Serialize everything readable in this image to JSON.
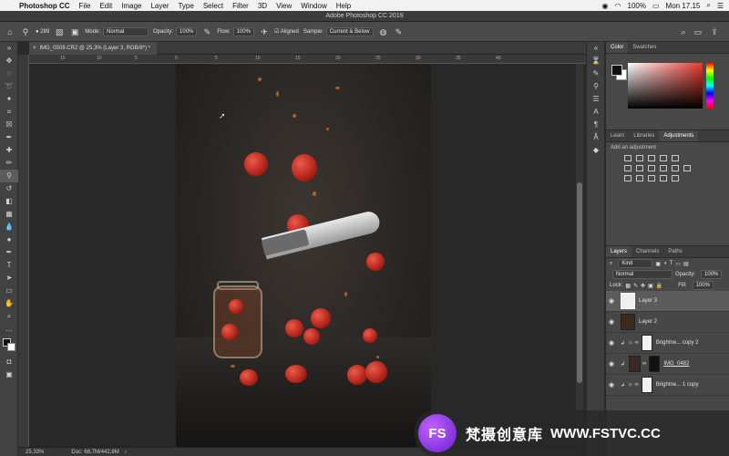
{
  "mac_menu": {
    "app": "Photoshop CC",
    "items": [
      "File",
      "Edit",
      "Image",
      "Layer",
      "Type",
      "Select",
      "Filter",
      "3D",
      "View",
      "Window",
      "Help"
    ],
    "battery": "100%",
    "time": "Mon 17.15"
  },
  "window_title": "Adobe Photoshop CC 2019",
  "options": {
    "brush_size": "289",
    "mode_label": "Mode:",
    "mode_value": "Normal",
    "opacity_label": "Opacity:",
    "opacity_value": "100%",
    "flow_label": "Flow:",
    "flow_value": "100%",
    "aligned_label": "Aligned",
    "sample_label": "Sample:",
    "sample_value": "Current & Below"
  },
  "document_tab": {
    "close": "×",
    "title": "IMG_0508.CR2 @ 25,3% (Layer 3, RGB/8*) *"
  },
  "ruler_labels": [
    "15",
    "10",
    "5",
    "0",
    "5",
    "10",
    "15",
    "20",
    "25",
    "30",
    "35",
    "40"
  ],
  "color_panel": {
    "tabs": [
      "Color",
      "Swatches"
    ]
  },
  "adjustments_panel": {
    "tabs": [
      "Learn",
      "Libraries",
      "Adjustments"
    ],
    "add_label": "Add an adjustment"
  },
  "layers_panel": {
    "tabs": [
      "Layers",
      "Channels",
      "Paths"
    ],
    "filter_value": "Kind",
    "blend_mode": "Normal",
    "opacity_label": "Opacity:",
    "opacity_value": "100%",
    "lock_label": "Lock:",
    "fill_label": "Fill:",
    "fill_value": "100%",
    "layers": [
      {
        "name": "Layer 3",
        "active": true
      },
      {
        "name": "Layer 2",
        "active": false
      },
      {
        "name": "Brightne... copy 2",
        "active": false
      },
      {
        "name": "IMG_0482",
        "active": false
      },
      {
        "name": "Brightne... 1 copy",
        "active": false
      }
    ]
  },
  "status": {
    "zoom": "25,33%",
    "doc": "Doc: 68,7M/442,8M"
  },
  "watermark": {
    "logo": "FS",
    "text": "梵摄创意库",
    "url": "WWW.FSTVC.CC"
  }
}
